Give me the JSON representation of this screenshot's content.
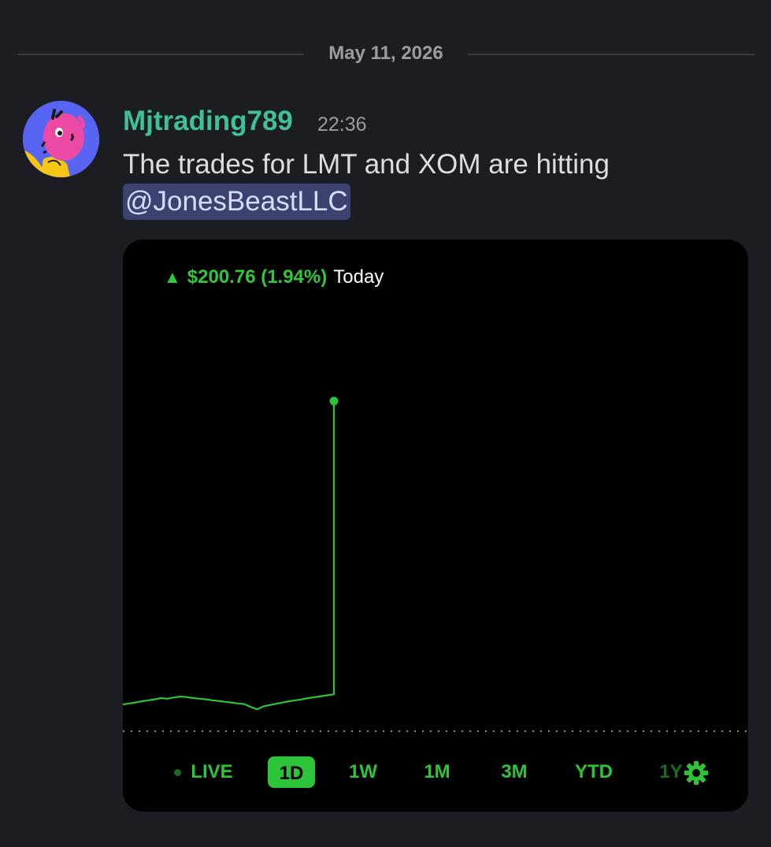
{
  "date_divider": "May 11, 2026",
  "message": {
    "author": "Mjtrading789",
    "time": "22:36",
    "text": "The trades for LMT and XOM are hitting",
    "mention": "@JonesBeastLLC"
  },
  "embed": {
    "change_amount": "$200.76 (1.94%)",
    "change_period": "Today",
    "ranges": [
      "LIVE",
      "1D",
      "1W",
      "1M",
      "3M",
      "YTD",
      "1Y"
    ],
    "active_range": "1D",
    "accent": "#2ec43a"
  },
  "chart_data": {
    "type": "line",
    "title": "",
    "xlabel": "",
    "ylabel": "",
    "grid": false,
    "legend": "none",
    "series": [
      {
        "values": [
          0.0,
          0.3,
          0.6,
          1.0,
          1.3,
          1.6,
          2.0,
          1.8,
          2.2,
          2.5,
          2.3,
          2.0,
          1.8,
          1.6,
          1.3,
          1.1,
          0.8,
          0.6,
          0.3,
          0.1,
          -0.8,
          -1.6,
          -0.6,
          -0.2,
          0.2,
          0.6,
          1.0,
          1.3,
          1.6,
          2.0,
          2.3,
          2.6,
          2.9,
          3.2,
          100.0
        ]
      }
    ]
  }
}
